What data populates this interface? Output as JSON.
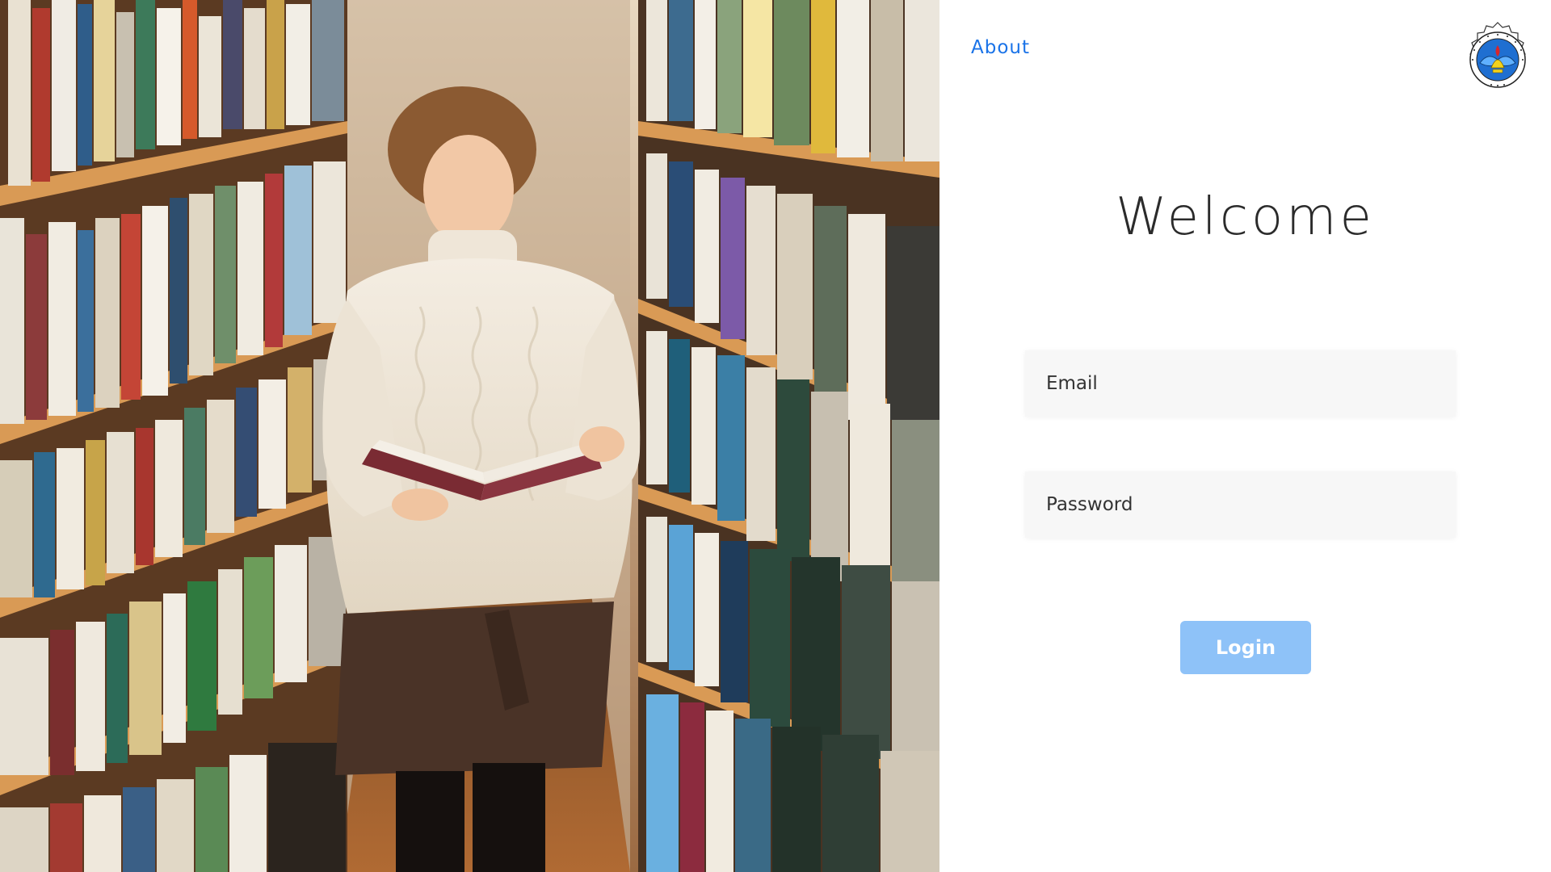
{
  "nav": {
    "about_label": "About"
  },
  "logo": {
    "icon": "school-emblem-icon",
    "colors": {
      "ring": "#ffffff",
      "blue": "#1f6fd1",
      "yellow": "#f2d21b",
      "red": "#d8262b"
    }
  },
  "main": {
    "title": "Welcome",
    "email": {
      "placeholder": "Email",
      "value": ""
    },
    "password": {
      "placeholder": "Password",
      "value": ""
    },
    "login_label": "Login"
  },
  "colors": {
    "link": "#1a73e8",
    "button_bg": "#8ec2f8",
    "button_text": "#ffffff",
    "title": "#2b2b2b",
    "field_bg": "#f7f7f7"
  }
}
